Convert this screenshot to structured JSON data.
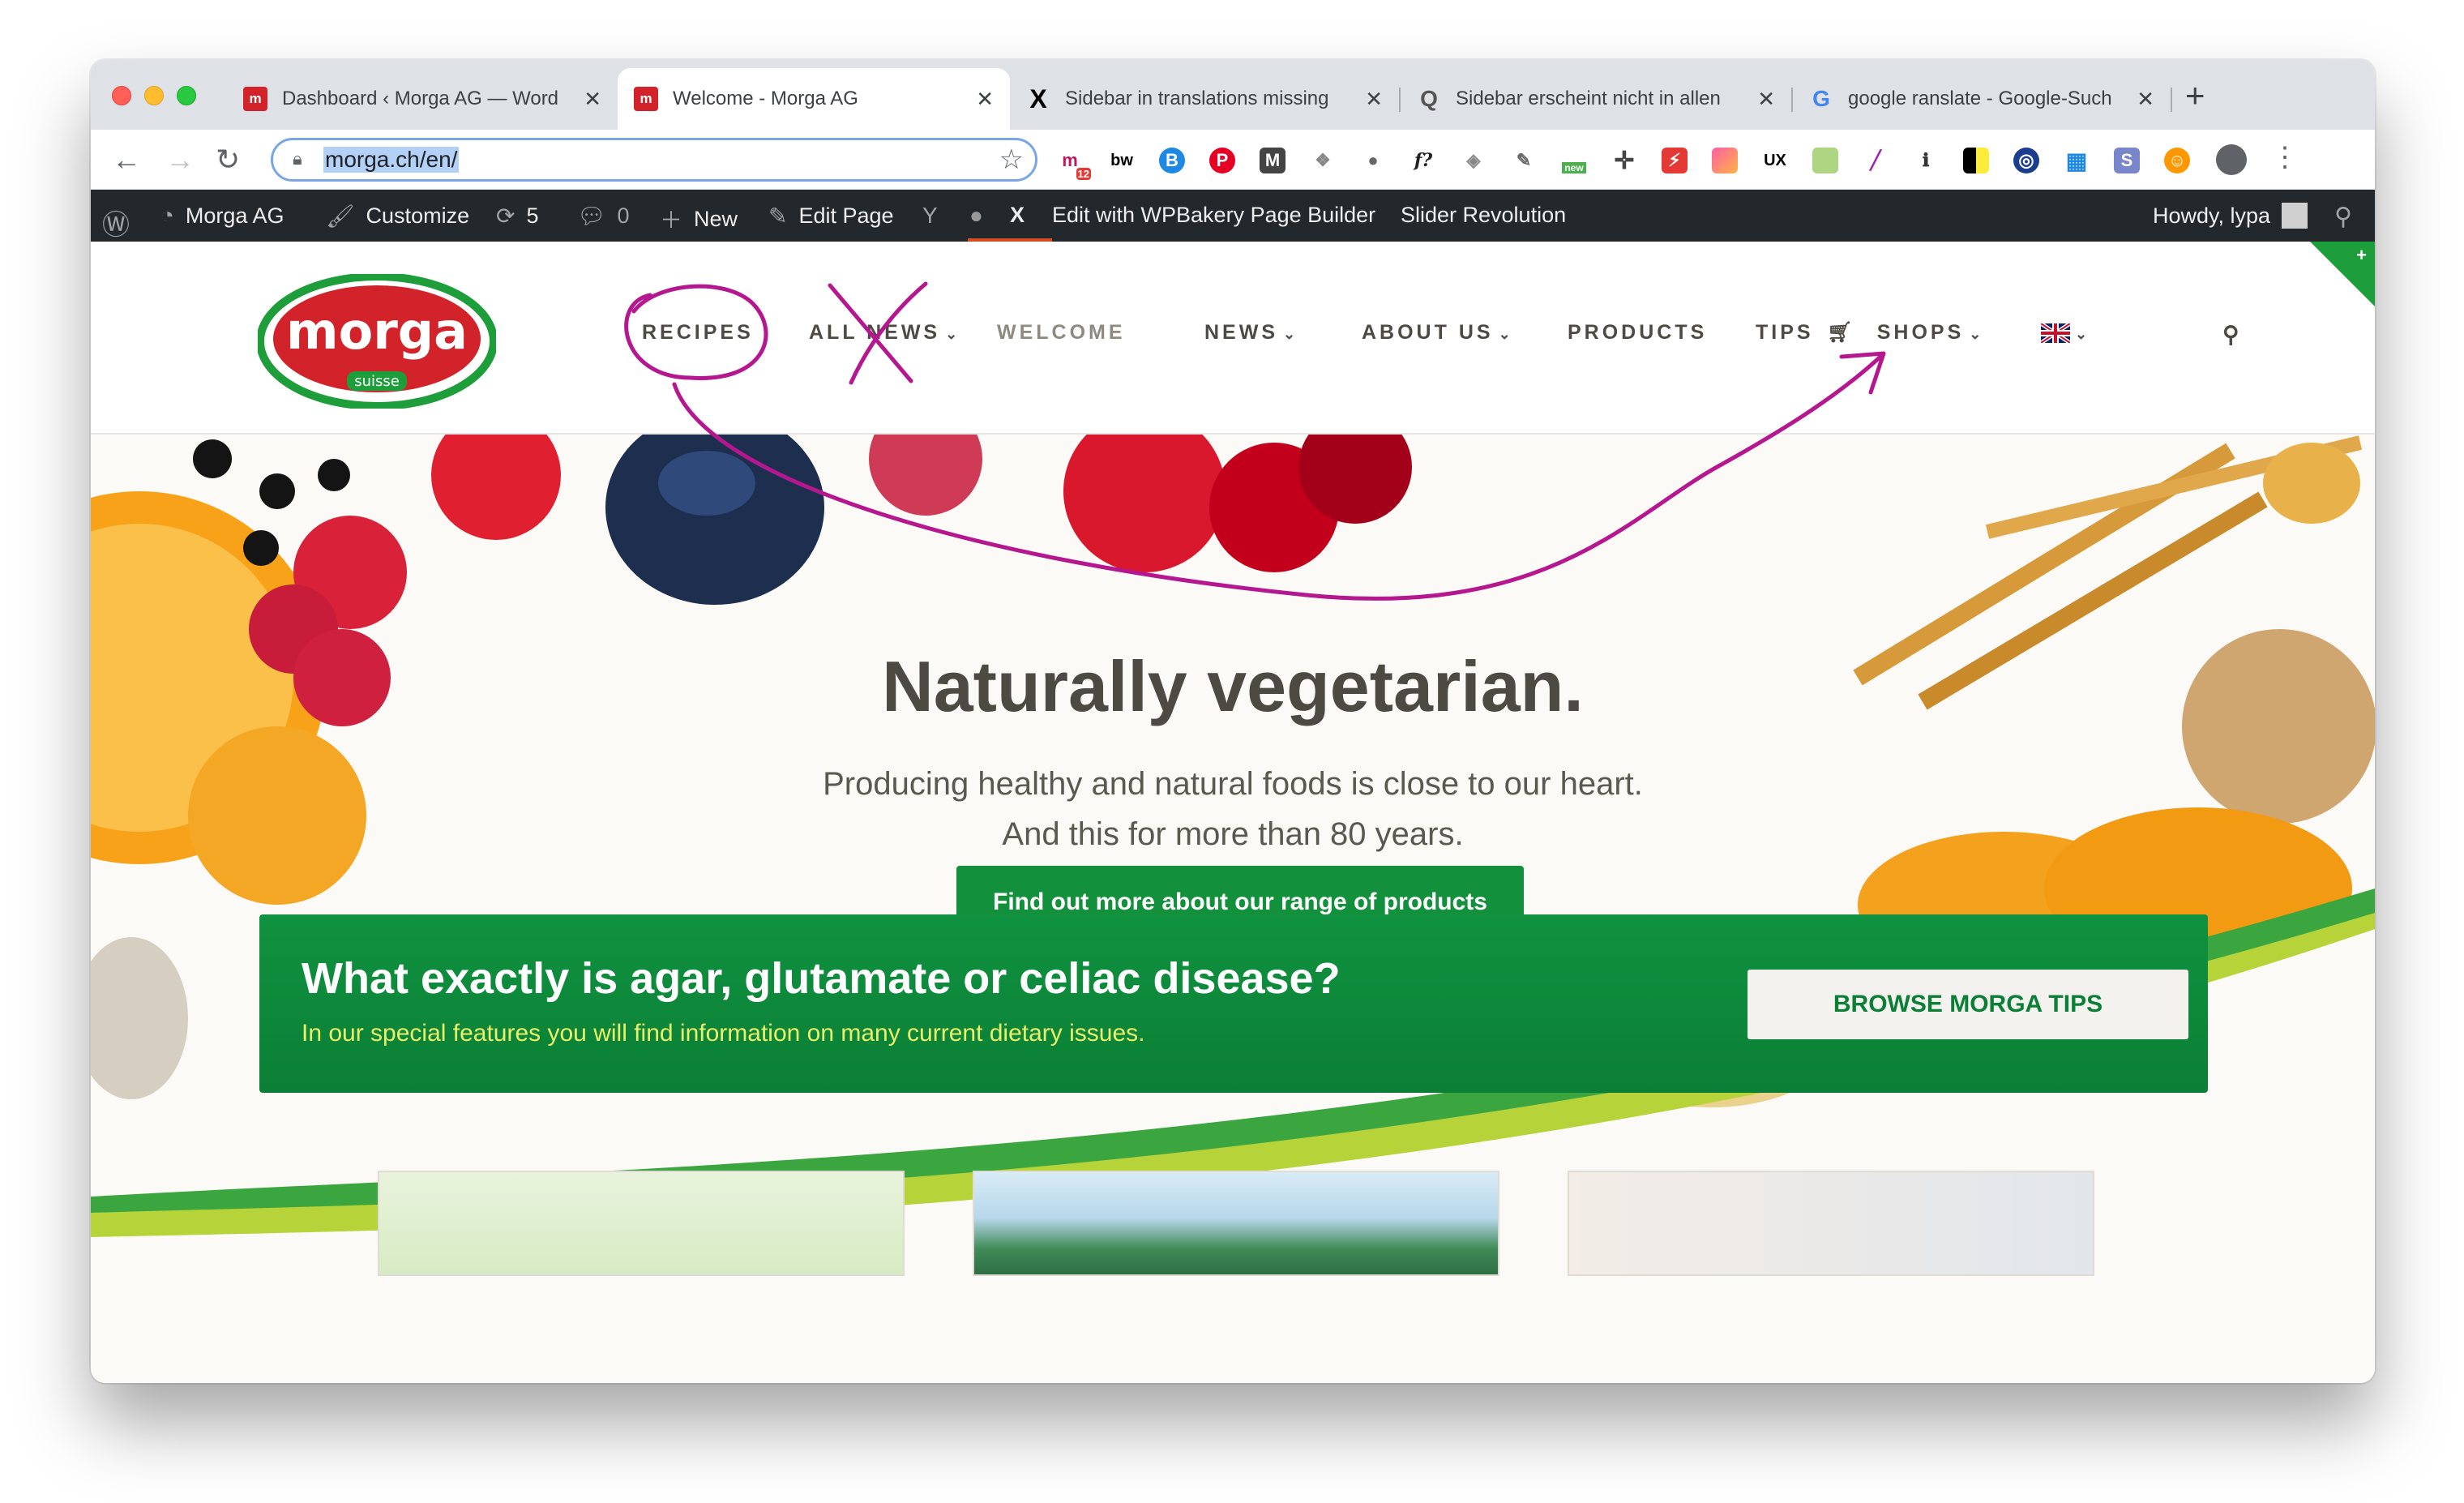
{
  "browser": {
    "tabs": [
      {
        "title": "Dashboard ‹ Morga AG — Word",
        "favicon": "morga-icon"
      },
      {
        "title": "Welcome - Morga AG",
        "favicon": "morga-icon"
      },
      {
        "title": "Sidebar in translations missing",
        "favicon": "x-icon"
      },
      {
        "title": "Sidebar erscheint nicht in allen",
        "favicon": "q-icon"
      },
      {
        "title": "google ranslate - Google-Such",
        "favicon": "google-icon"
      }
    ],
    "new_tab": "+",
    "close_glyph": "✕",
    "address": "morga.ch/en/",
    "extensions": {
      "badge_count": "12",
      "bw": "bw",
      "ux": "UX",
      "new_badge": "new",
      "fx": "f?"
    }
  },
  "adminbar": {
    "site_name": "Morga AG",
    "customize": "Customize",
    "updates": "5",
    "comments": "0",
    "new": "New",
    "edit_page": "Edit Page",
    "x": "X",
    "wpbakery": "Edit with WPBakery Page Builder",
    "slider": "Slider Revolution",
    "howdy": "Howdy, lypa"
  },
  "site": {
    "logo": {
      "word": "morga",
      "sub": "suisse"
    },
    "nav": {
      "recipes": "RECIPES",
      "all_news": "ALL NEWS",
      "welcome": "WELCOME",
      "news": "NEWS",
      "about": "ABOUT US",
      "products": "PRODUCTS",
      "tips": "TIPS",
      "shops": "SHOPS"
    },
    "hero": {
      "title": "Naturally vegetarian.",
      "line1": "Producing healthy and natural foods is close to our heart.",
      "line2": "And this for more than 80 years.",
      "cta": "Find out more about our range of products"
    },
    "banner": {
      "title": "What exactly is agar, glutamate or celiac disease?",
      "subtitle": "In our special features you will find information on many current dietary issues.",
      "button": "BROWSE MORGA TIPS"
    }
  },
  "colors": {
    "brand_green": "#12903b",
    "brand_red": "#d2232a",
    "annotation": "#b5178f",
    "admin_bar": "#23282d"
  }
}
